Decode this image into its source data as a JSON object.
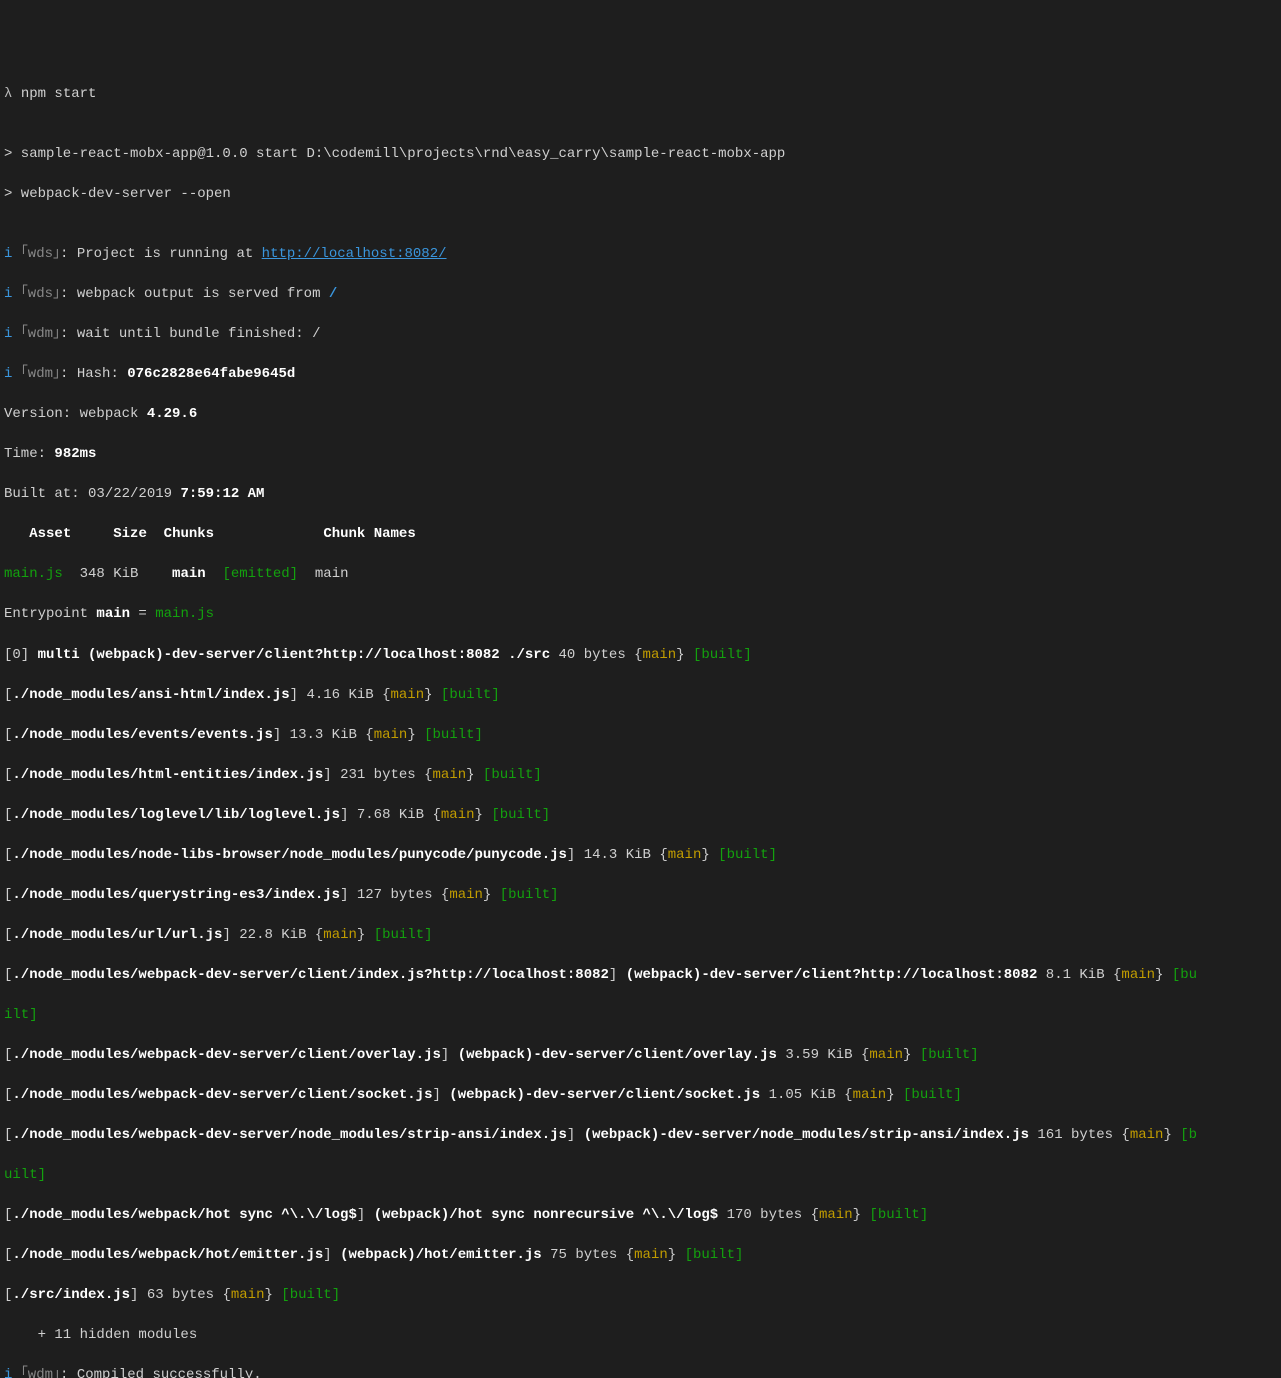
{
  "prompt": {
    "lambda": "λ",
    "cmd": "npm start"
  },
  "script_lines": {
    "l1": "> sample-react-mobx-app@1.0.0 start D:\\codemill\\projects\\rnd\\easy_carry\\sample-react-mobx-app",
    "l2": "> webpack-dev-server --open"
  },
  "info_prefix": "i",
  "wds_label": "｢wds｣",
  "wdm_label": "｢wdm｣",
  "wds_project_running": ": Project is running at ",
  "wds_url": "http://localhost:8082/",
  "wds_output_served": ": webpack output is served from ",
  "wds_served_path": "/",
  "wdm_wait": ": wait until bundle finished: /",
  "wdm_hash_label": ": Hash: ",
  "wdm_hash": "076c2828e64fabe9645d",
  "version_line_a": "Version: webpack ",
  "version_line_b": "4.29.6",
  "time_line_a": "Time: ",
  "time_line_b": "982ms",
  "built_at_a": "Built at: 03/22/2019 ",
  "built_at_b": "7:59:12 AM",
  "header": {
    "asset": "Asset",
    "size": "Size",
    "chunks": "Chunks",
    "chunk_names": "Chunk Names"
  },
  "asset_row": {
    "name": "main.js",
    "size": "348 KiB",
    "chunk": "main",
    "emitted": "[emitted]",
    "chunk_name": "main"
  },
  "entrypoint_a": "Entrypoint ",
  "entrypoint_b": "main",
  "entrypoint_c": " = ",
  "entrypoint_d": "main.js",
  "main_kw": "main",
  "built_kw": "built",
  "modules": [
    {
      "idx": "[0]",
      "name": "multi (webpack)-dev-server/client?http://localhost:8082 ./src",
      "size": "40 bytes"
    },
    {
      "idx": "[",
      "path": "./node_modules/ansi-html/index.js",
      "close": "]",
      "size": "4.16 KiB"
    },
    {
      "idx": "[",
      "path": "./node_modules/events/events.js",
      "close": "]",
      "size": "13.3 KiB"
    },
    {
      "idx": "[",
      "path": "./node_modules/html-entities/index.js",
      "close": "]",
      "size": "231 bytes"
    },
    {
      "idx": "[",
      "path": "./node_modules/loglevel/lib/loglevel.js",
      "close": "]",
      "size": "7.68 KiB"
    },
    {
      "idx": "[",
      "path": "./node_modules/node-libs-browser/node_modules/punycode/punycode.js",
      "close": "]",
      "size": "14.3 KiB"
    },
    {
      "idx": "[",
      "path": "./node_modules/querystring-es3/index.js",
      "close": "]",
      "size": "127 bytes"
    },
    {
      "idx": "[",
      "path": "./node_modules/url/url.js",
      "close": "]",
      "size": "22.8 KiB"
    },
    {
      "idx": "[",
      "path": "./node_modules/webpack-dev-server/client/index.js?http://localhost:8082",
      "close": "]",
      "alt": "(webpack)-dev-server/client?http://localhost:8082",
      "size": "8.1 KiB"
    },
    {
      "idx": "[",
      "path": "./node_modules/webpack-dev-server/client/overlay.js",
      "close": "]",
      "alt": "(webpack)-dev-server/client/overlay.js",
      "size": "3.59 KiB"
    },
    {
      "idx": "[",
      "path": "./node_modules/webpack-dev-server/client/socket.js",
      "close": "]",
      "alt": "(webpack)-dev-server/client/socket.js",
      "size": "1.05 KiB"
    },
    {
      "idx": "[",
      "path": "./node_modules/webpack-dev-server/node_modules/strip-ansi/index.js",
      "close": "]",
      "alt": "(webpack)-dev-server/node_modules/strip-ansi/index.js",
      "size": "161 bytes"
    },
    {
      "idx": "[",
      "path": "./node_modules/webpack/hot sync ^\\.\\/log$",
      "close": "]",
      "alt": "(webpack)/hot sync nonrecursive ^\\.\\/log$",
      "size": "170 bytes"
    },
    {
      "idx": "[",
      "path": "./node_modules/webpack/hot/emitter.js",
      "close": "]",
      "alt": "(webpack)/hot/emitter.js",
      "size": "75 bytes"
    },
    {
      "idx": "[",
      "path": "./src/index.js",
      "close": "]",
      "size": "63 bytes"
    }
  ],
  "hidden_modules": "    + 11 hidden modules",
  "compiled_success": ": Compiled successfully.",
  "wrap_built_a": "[bu",
  "wrap_built_b": "ilt]",
  "wrap_built_c": "[b",
  "wrap_built_d": "uilt]"
}
